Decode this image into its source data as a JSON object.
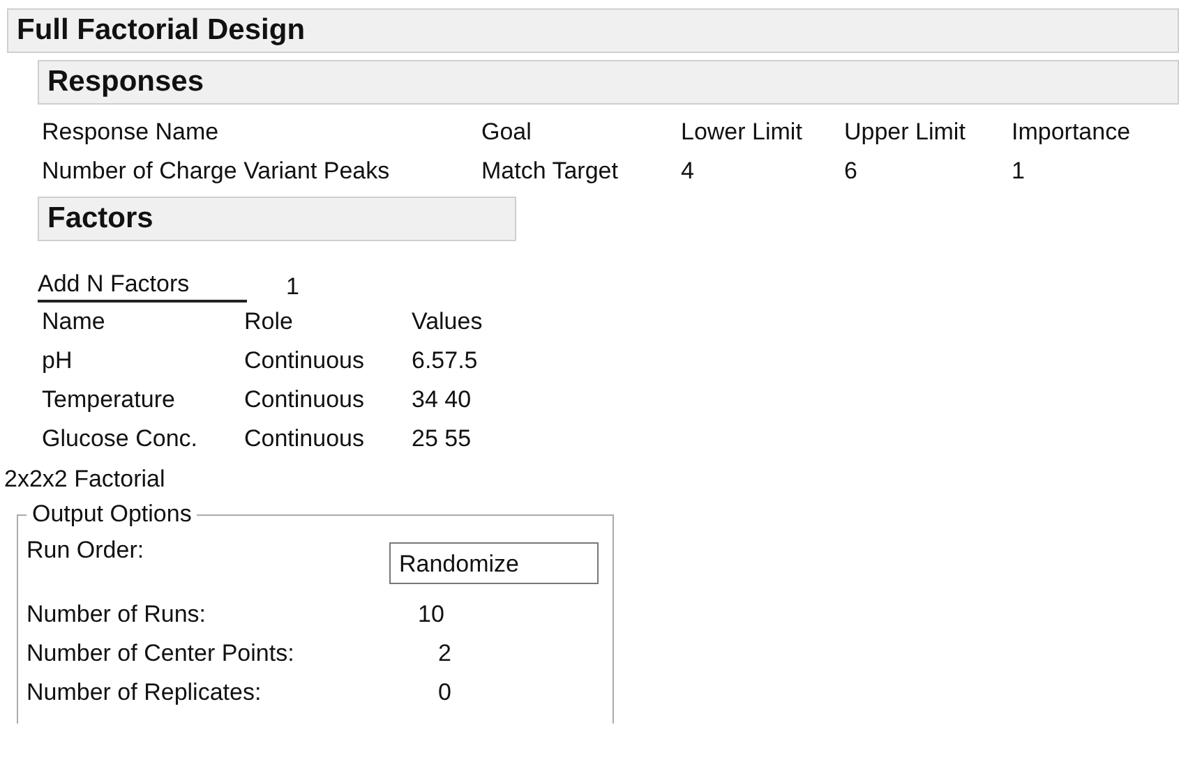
{
  "title": "Full Factorial Design",
  "responses": {
    "header": "Responses",
    "columns": [
      "Response Name",
      "Goal",
      "Lower Limit",
      "Upper Limit",
      "Importance"
    ],
    "rows": [
      [
        "Number of Charge Variant Peaks",
        "Match Target",
        "4",
        "6",
        "1"
      ]
    ]
  },
  "factors": {
    "header": "Factors",
    "add_label": "Add N Factors",
    "add_value": "1",
    "columns": [
      "Name",
      "Role",
      "Values"
    ],
    "rows": [
      [
        "pH",
        "Continuous",
        "6.57.5"
      ],
      [
        "Temperature",
        "Continuous",
        "34 40"
      ],
      [
        "Glucose Conc.",
        "Continuous",
        "25 55"
      ]
    ]
  },
  "design_label": "2x2x2 Factorial",
  "output_options": {
    "legend": "Output Options",
    "run_order_label": "Run Order:",
    "run_order_value": "Randomize",
    "runs_label": "Number of Runs:",
    "runs_value": "10",
    "center_points_label": "Number of Center Points:",
    "center_points_value": "2",
    "replicates_label": "Number of Replicates:",
    "replicates_value": "0"
  }
}
